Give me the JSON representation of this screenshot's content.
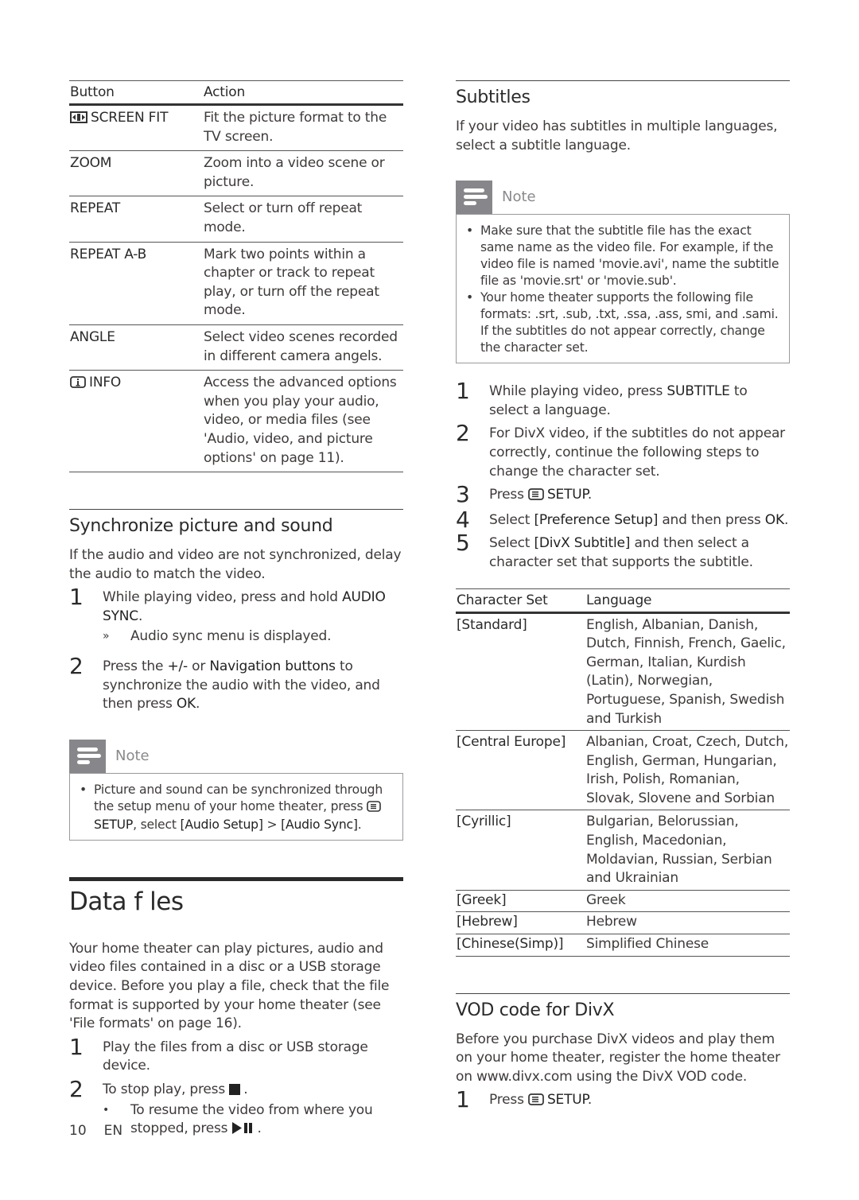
{
  "left": {
    "button_table": {
      "headers": [
        "Button",
        "Action"
      ],
      "rows": [
        {
          "icon": "screen-fit-icon",
          "button": "SCREEN FIT",
          "action": "Fit the picture format to the TV screen."
        },
        {
          "icon": "",
          "button": "ZOOM",
          "action": "Zoom into a video scene or picture."
        },
        {
          "icon": "",
          "button": "REPEAT",
          "action": "Select or turn off repeat mode."
        },
        {
          "icon": "",
          "button": "REPEAT A-B",
          "action": "Mark two points within a chapter or track to repeat play, or turn off the repeat mode."
        },
        {
          "icon": "",
          "button": "ANGLE",
          "action": "Select video scenes recorded in different camera angels."
        },
        {
          "icon": "info-icon",
          "button": "INFO",
          "action": "Access the advanced options when you play your audio, video, or media files (see 'Audio, video, and picture options' on page 11)."
        }
      ]
    },
    "sync": {
      "title": "Synchronize picture and sound",
      "intro": "If the audio and video are not synchronized, delay the audio to match the video.",
      "steps": [
        {
          "num": "1",
          "pre": "While playing video, press and hold ",
          "bold": "AUDIO SYNC",
          "post": ".",
          "result_marker": "»",
          "result": "Audio sync menu is displayed."
        },
        {
          "num": "2",
          "pre": "Press the ",
          "bold1": "+/-",
          "mid": " or ",
          "bold2": "Navigation buttons",
          "post": " to synchronize the audio with the video, and then press ",
          "bold3": "OK",
          "end": "."
        }
      ],
      "note": {
        "label": "Note",
        "pre": "Picture and sound can be synchronized through the setup menu of your home theater, press ",
        "bold1": "SETUP",
        "mid": ", select ",
        "bold2": "[Audio Setup]",
        "sep": " > ",
        "bold3": "[Audio Sync]",
        "end": "."
      }
    },
    "data_files": {
      "title": "Data f les",
      "intro": "Your home theater can play pictures, audio and video files contained in a disc or a USB storage device. Before you play a file, check that the file format is supported by your home theater (see 'File formats' on page 16).",
      "steps": [
        {
          "num": "1",
          "text": "Play the files from a disc or USB storage device."
        },
        {
          "num": "2",
          "pre": "To stop play, press ",
          "post": ".",
          "sub_marker": "•",
          "sub_pre": "To resume the video from where you stopped, press ",
          "sub_post": "."
        }
      ]
    }
  },
  "right": {
    "subtitles": {
      "title": "Subtitles",
      "intro": "If your video has subtitles in multiple languages, select a subtitle language.",
      "note": {
        "label": "Note",
        "bullets": [
          "Make sure that the subtitle file has the exact same name as the video file. For example, if the video file is named 'movie.avi', name the subtitle file as 'movie.srt' or 'movie.sub'.",
          "Your home theater supports the following file formats: .srt, .sub, .txt, .ssa, .ass, smi, and .sami. If the subtitles do not appear correctly, change the character set."
        ]
      },
      "steps": [
        {
          "num": "1",
          "pre": "While playing video, press ",
          "bold": "SUBTITLE",
          "post": " to select a language."
        },
        {
          "num": "2",
          "text": "For DivX video, if the subtitles do not appear correctly, continue the following steps to change the character set."
        },
        {
          "num": "3",
          "pre": "Press ",
          "bold": "SETUP",
          "post": "."
        },
        {
          "num": "4",
          "pre": "Select ",
          "bold": "[Preference Setup]",
          "mid": " and then press ",
          "bold2": "OK",
          "post": "."
        },
        {
          "num": "5",
          "pre": "Select ",
          "bold": "[DivX Subtitle]",
          "post": " and then select a character set that supports the subtitle."
        }
      ]
    },
    "charset_table": {
      "headers": [
        "Character Set",
        "Language"
      ],
      "rows": [
        {
          "set": "[Standard]",
          "languages": "English, Albanian, Danish, Dutch, Finnish, French, Gaelic, German, Italian, Kurdish (Latin), Norwegian, Portuguese, Spanish, Swedish and Turkish"
        },
        {
          "set": "[Central Europe]",
          "languages": "Albanian, Croat, Czech, Dutch, English, German, Hungarian, Irish, Polish, Romanian, Slovak, Slovene and Sorbian"
        },
        {
          "set": "[Cyrillic]",
          "languages": "Bulgarian, Belorussian, English, Macedonian, Moldavian, Russian, Serbian and Ukrainian"
        },
        {
          "set": "[Greek]",
          "languages": "Greek"
        },
        {
          "set": "[Hebrew]",
          "languages": "Hebrew"
        },
        {
          "set": "[Chinese(Simp)]",
          "languages": "Simplified Chinese"
        }
      ]
    },
    "vod": {
      "title": "VOD code for DivX",
      "intro": "Before you purchase DivX videos and play them on your home theater, register the home theater on www.divx.com using the DivX VOD code.",
      "steps": [
        {
          "num": "1",
          "pre": "Press ",
          "bold": "SETUP",
          "post": "."
        }
      ]
    }
  },
  "footer": {
    "page": "10",
    "lang": "EN"
  }
}
